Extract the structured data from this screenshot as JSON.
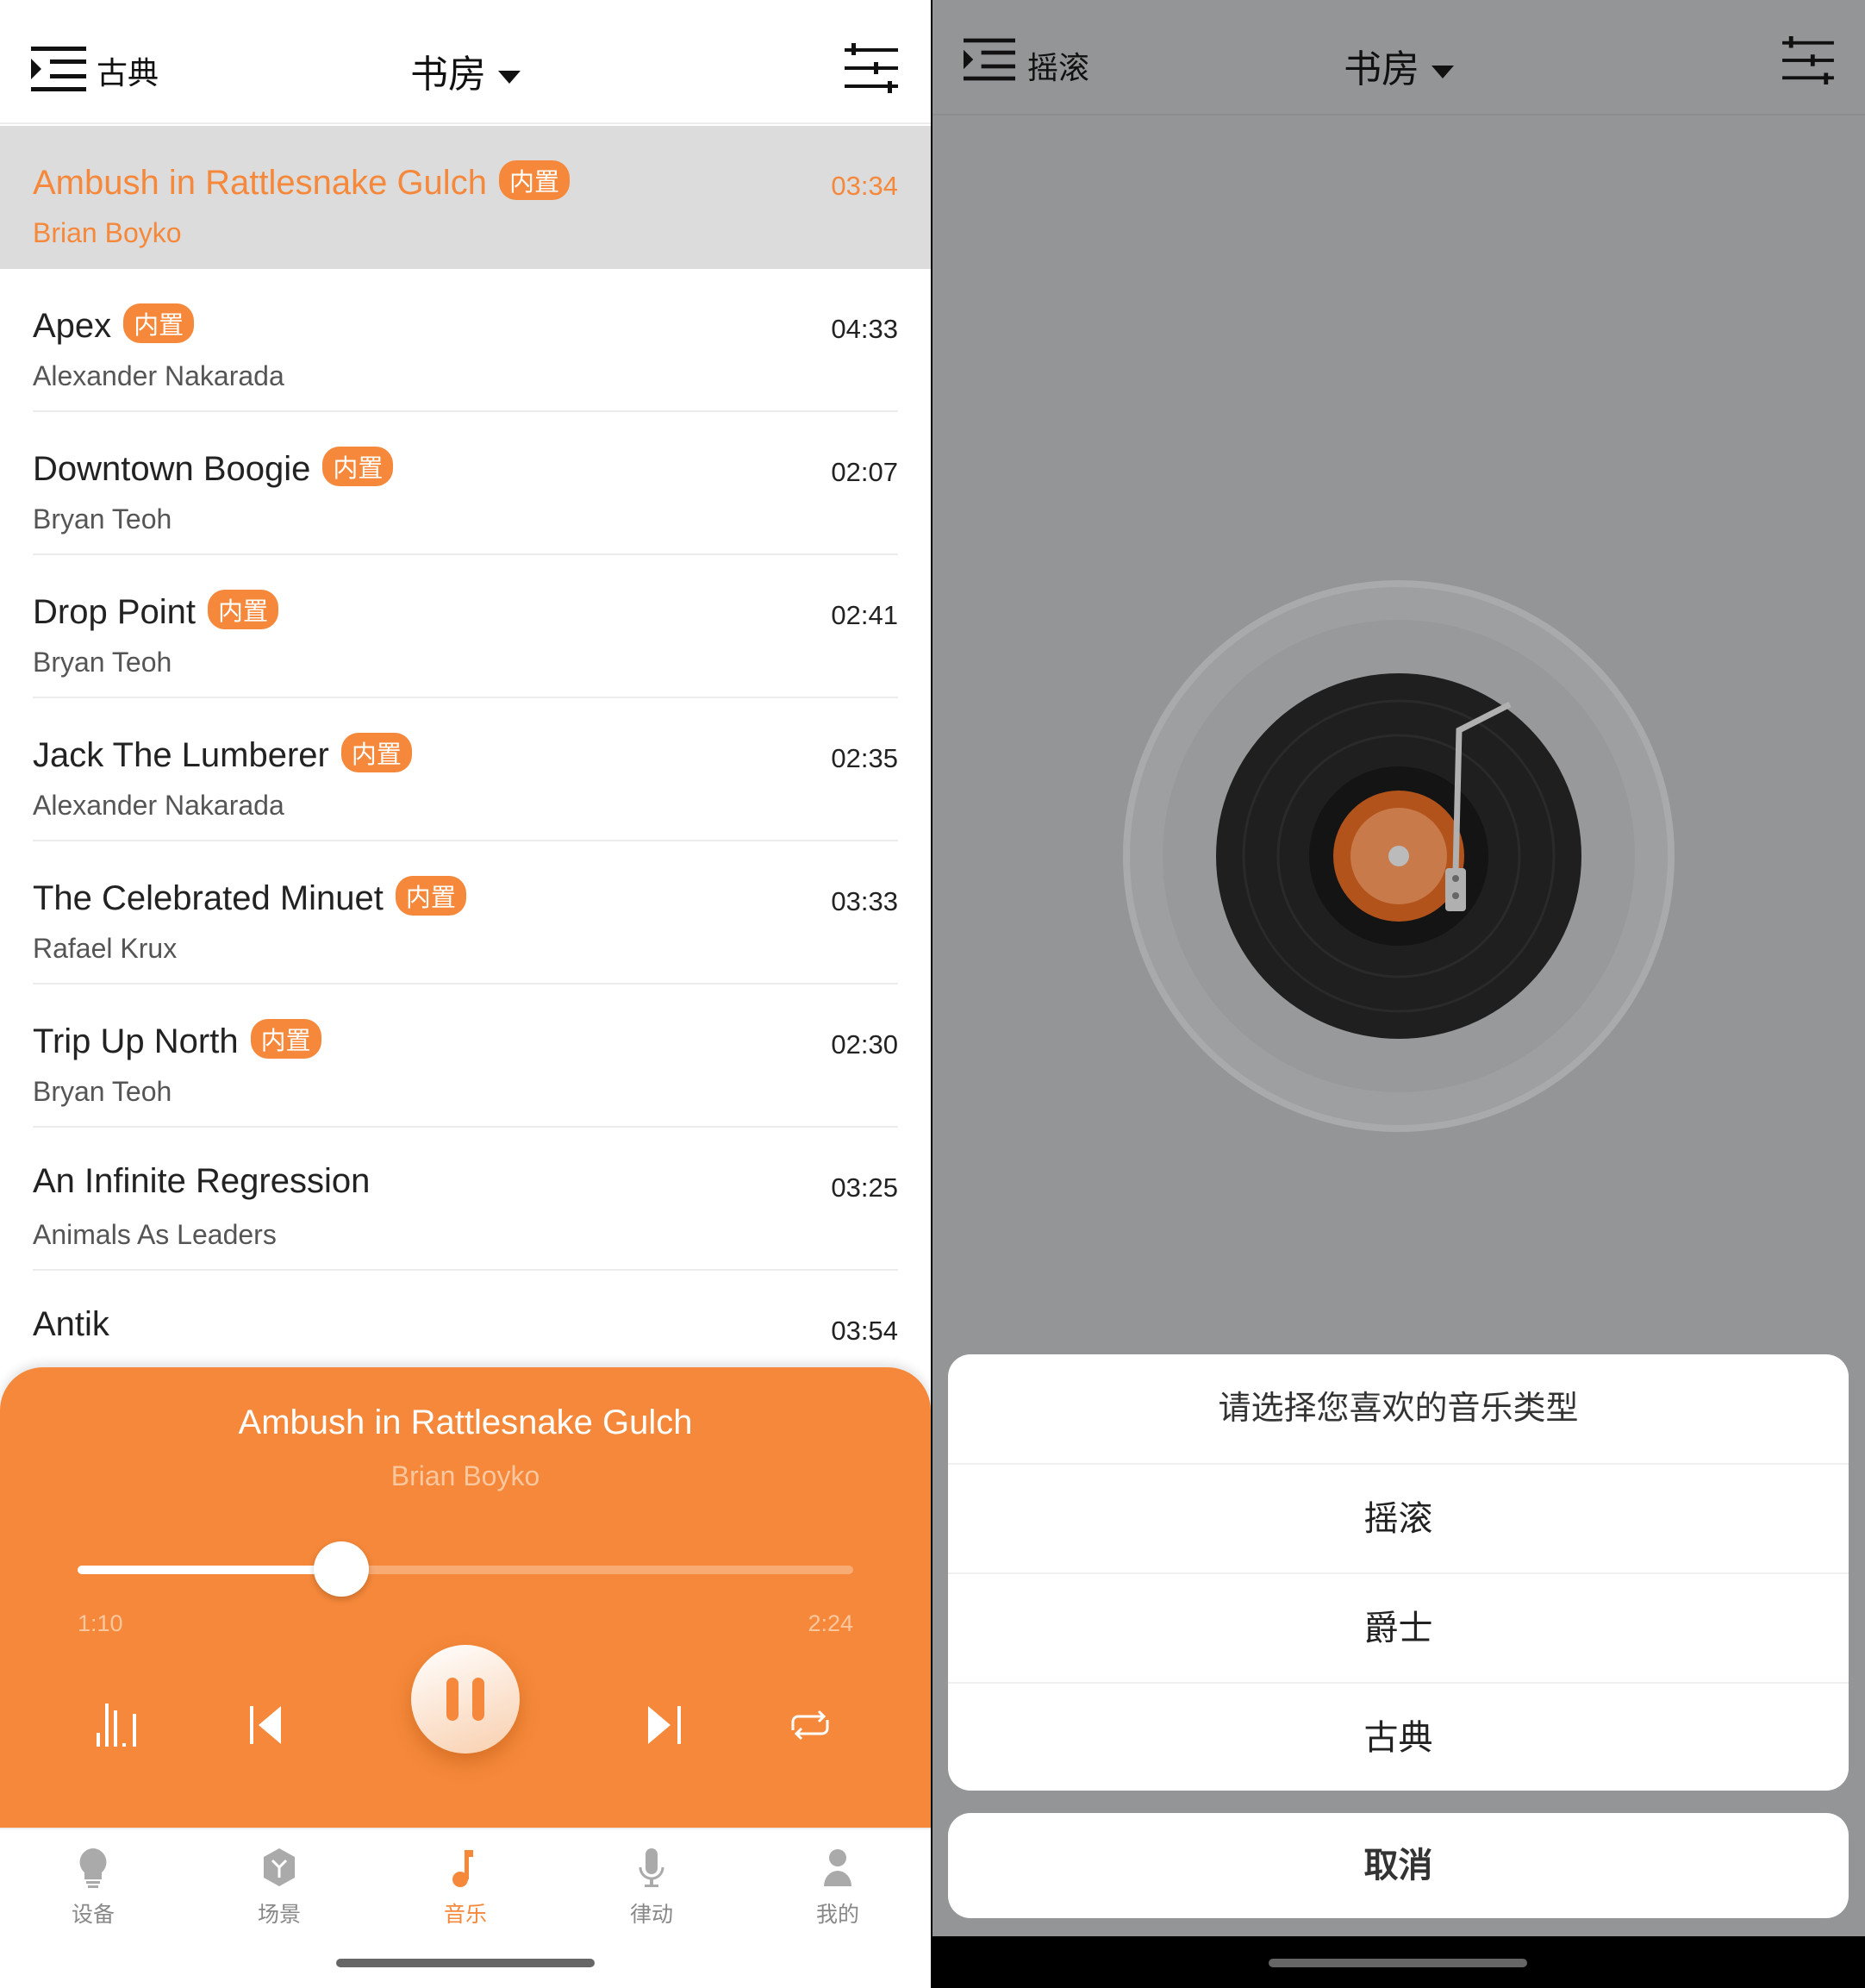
{
  "left": {
    "header": {
      "category": "古典",
      "room": "书房",
      "menu_icon": "menu-indent-icon",
      "settings_icon": "sliders-icon"
    },
    "songs": [
      {
        "title": "Ambush in Rattlesnake Gulch",
        "badge": "内置",
        "artist": "Brian Boyko",
        "duration": "03:34",
        "active": true
      },
      {
        "title": "Apex",
        "badge": "内置",
        "artist": "Alexander Nakarada",
        "duration": "04:33"
      },
      {
        "title": "Downtown Boogie",
        "badge": "内置",
        "artist": "Bryan Teoh",
        "duration": "02:07"
      },
      {
        "title": "Drop Point",
        "badge": "内置",
        "artist": "Bryan Teoh",
        "duration": "02:41"
      },
      {
        "title": "Jack The Lumberer",
        "badge": "内置",
        "artist": "Alexander Nakarada",
        "duration": "02:35"
      },
      {
        "title": "The Celebrated Minuet",
        "badge": "内置",
        "artist": "Rafael Krux",
        "duration": "03:33"
      },
      {
        "title": "Trip Up North",
        "badge": "内置",
        "artist": "Bryan Teoh",
        "duration": "02:30"
      },
      {
        "title": "An Infinite Regression",
        "badge": "",
        "artist": "Animals As Leaders",
        "duration": "03:25"
      },
      {
        "title": "Antik",
        "badge": "",
        "artist": "",
        "duration": "03:54"
      }
    ],
    "player": {
      "title": "Ambush in Rattlesnake Gulch",
      "artist": "Brian Boyko",
      "current": "1:10",
      "total": "2:24",
      "progress_percent": 34,
      "state": "playing"
    },
    "nav": [
      {
        "label": "设备",
        "icon": "bulb-icon"
      },
      {
        "label": "场景",
        "icon": "cube-icon"
      },
      {
        "label": "音乐",
        "icon": "music-note-icon",
        "active": true
      },
      {
        "label": "律动",
        "icon": "microphone-icon"
      },
      {
        "label": "我的",
        "icon": "user-icon"
      }
    ]
  },
  "right": {
    "header": {
      "category": "摇滚",
      "room": "书房"
    },
    "sheet": {
      "question": "请选择您喜欢的音乐类型",
      "options": [
        "摇滚",
        "爵士",
        "古典"
      ],
      "cancel": "取消"
    }
  },
  "colors": {
    "accent": "#f5883a",
    "overlay": "#949597"
  }
}
